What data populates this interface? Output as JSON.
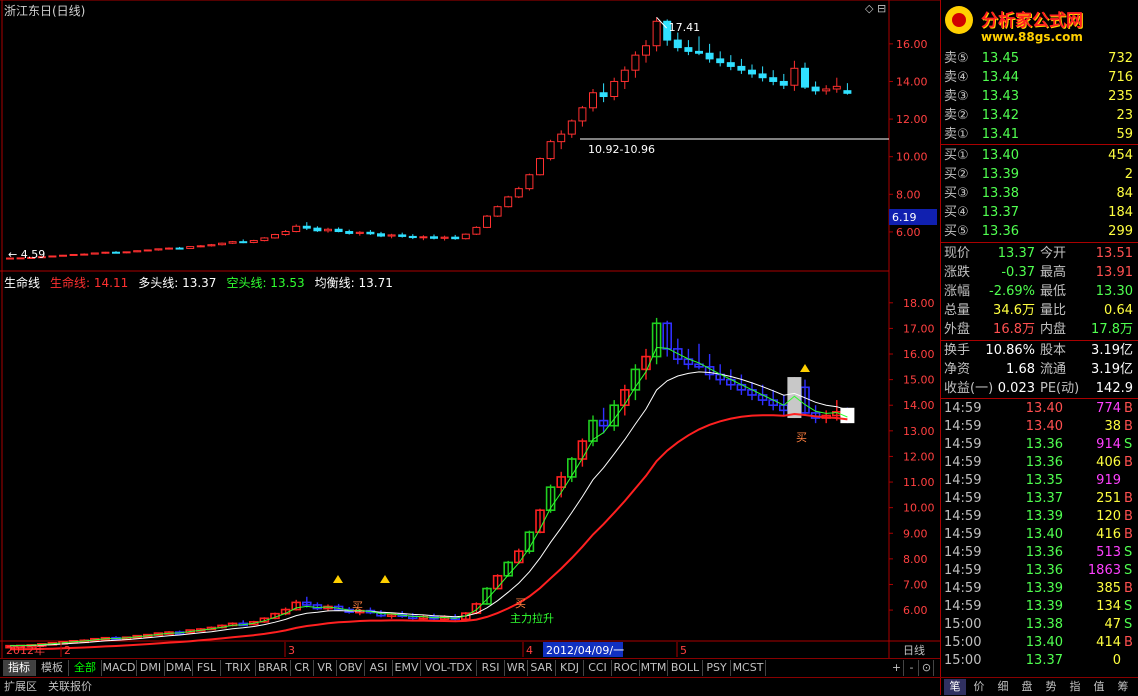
{
  "title": "浙江东日(日线)",
  "logo": {
    "text": "分析家公式网",
    "url": "www.88gs.com"
  },
  "upper": {
    "annotations": {
      "high": "17.41",
      "range": "10.92-10.96",
      "low": "4.59"
    },
    "price_ticks": [
      "16.00",
      "14.00",
      "12.00",
      "10.00",
      "8.00",
      "6.00"
    ],
    "current_price_box": "6.19"
  },
  "lower": {
    "legend": [
      {
        "name": "生命线",
        "value": "",
        "color": "#ffffff"
      },
      {
        "name": "生命线:",
        "value": "14.11",
        "color": "#ff3030"
      },
      {
        "name": "多头线:",
        "value": "13.37",
        "color": "#ffffff"
      },
      {
        "name": "空头线:",
        "value": "13.53",
        "color": "#30ff30"
      },
      {
        "name": "均衡线:",
        "value": "13.71",
        "color": "#ffffff"
      }
    ],
    "price_ticks": [
      "18.00",
      "17.00",
      "16.00",
      "15.00",
      "14.00",
      "13.00",
      "12.00",
      "11.00",
      "10.00",
      "9.00",
      "8.00",
      "7.00",
      "6.00"
    ],
    "labels": {
      "buy1": "买",
      "buy2": "买",
      "buy3": "买",
      "mainforce": "主力拉升"
    }
  },
  "date_axis": {
    "year": "2012年",
    "marks": [
      "2",
      "3",
      "4",
      "5"
    ],
    "cursor_date": "2012/04/09/一",
    "period": "日线"
  },
  "order_book": {
    "asks": [
      {
        "label": "卖⑤",
        "price": "13.45",
        "vol": "732"
      },
      {
        "label": "卖④",
        "price": "13.44",
        "vol": "716"
      },
      {
        "label": "卖③",
        "price": "13.43",
        "vol": "235"
      },
      {
        "label": "卖②",
        "price": "13.42",
        "vol": "23"
      },
      {
        "label": "卖①",
        "price": "13.41",
        "vol": "59"
      }
    ],
    "bids": [
      {
        "label": "买①",
        "price": "13.40",
        "vol": "454"
      },
      {
        "label": "买②",
        "price": "13.39",
        "vol": "2"
      },
      {
        "label": "买③",
        "price": "13.38",
        "vol": "84"
      },
      {
        "label": "买④",
        "price": "13.37",
        "vol": "184"
      },
      {
        "label": "买⑤",
        "price": "13.36",
        "vol": "299"
      }
    ]
  },
  "quote": [
    {
      "l1": "现价",
      "v1": "13.37",
      "c1": "grn",
      "l2": "今开",
      "v2": "13.51",
      "c2": "red"
    },
    {
      "l1": "涨跌",
      "v1": "-0.37",
      "c1": "grn",
      "l2": "最高",
      "v2": "13.91",
      "c2": "red"
    },
    {
      "l1": "涨幅",
      "v1": "-2.69%",
      "c1": "grn",
      "l2": "最低",
      "v2": "13.30",
      "c2": "grn"
    },
    {
      "l1": "总量",
      "v1": "34.6万",
      "c1": "yel",
      "l2": "量比",
      "v2": "0.64",
      "c2": "yel"
    },
    {
      "l1": "外盘",
      "v1": "16.8万",
      "c1": "red",
      "l2": "内盘",
      "v2": "17.8万",
      "c2": "grn"
    },
    {
      "l1": "换手",
      "v1": "10.86%",
      "c1": "wht",
      "l2": "股本",
      "v2": "3.19亿",
      "c2": "wht"
    },
    {
      "l1": "净资",
      "v1": "1.68",
      "c1": "wht",
      "l2": "流通",
      "v2": "3.19亿",
      "c2": "wht"
    },
    {
      "l1": "收益(一)",
      "v1": "0.023",
      "c1": "wht",
      "l2": "PE(动)",
      "v2": "142.9",
      "c2": "wht"
    }
  ],
  "ticks": [
    {
      "t": "14:59",
      "p": "13.40",
      "q": "774",
      "s": "B",
      "pc": "red",
      "qc": "mag",
      "sc": "red"
    },
    {
      "t": "14:59",
      "p": "13.40",
      "q": "38",
      "s": "B",
      "pc": "red",
      "qc": "yel",
      "sc": "red"
    },
    {
      "t": "14:59",
      "p": "13.36",
      "q": "914",
      "s": "S",
      "pc": "grn",
      "qc": "mag",
      "sc": "grn"
    },
    {
      "t": "14:59",
      "p": "13.36",
      "q": "406",
      "s": "B",
      "pc": "grn",
      "qc": "yel",
      "sc": "red"
    },
    {
      "t": "14:59",
      "p": "13.35",
      "q": "919",
      "s": "",
      "pc": "grn",
      "qc": "mag",
      "sc": "wht"
    },
    {
      "t": "14:59",
      "p": "13.37",
      "q": "251",
      "s": "B",
      "pc": "grn",
      "qc": "yel",
      "sc": "red"
    },
    {
      "t": "14:59",
      "p": "13.39",
      "q": "120",
      "s": "B",
      "pc": "grn",
      "qc": "yel",
      "sc": "red"
    },
    {
      "t": "14:59",
      "p": "13.40",
      "q": "416",
      "s": "B",
      "pc": "grn",
      "qc": "yel",
      "sc": "red"
    },
    {
      "t": "14:59",
      "p": "13.36",
      "q": "513",
      "s": "S",
      "pc": "grn",
      "qc": "mag",
      "sc": "grn"
    },
    {
      "t": "14:59",
      "p": "13.36",
      "q": "1863",
      "s": "S",
      "pc": "grn",
      "qc": "mag",
      "sc": "grn"
    },
    {
      "t": "14:59",
      "p": "13.39",
      "q": "385",
      "s": "B",
      "pc": "grn",
      "qc": "yel",
      "sc": "red"
    },
    {
      "t": "14:59",
      "p": "13.39",
      "q": "134",
      "s": "S",
      "pc": "grn",
      "qc": "yel",
      "sc": "grn"
    },
    {
      "t": "15:00",
      "p": "13.38",
      "q": "47",
      "s": "S",
      "pc": "grn",
      "qc": "yel",
      "sc": "grn"
    },
    {
      "t": "15:00",
      "p": "13.40",
      "q": "414",
      "s": "B",
      "pc": "grn",
      "qc": "yel",
      "sc": "red"
    },
    {
      "t": "15:00",
      "p": "13.37",
      "q": "0",
      "s": "",
      "pc": "grn",
      "qc": "yel",
      "sc": "wht"
    }
  ],
  "indicator_tabs": [
    "指标",
    "模板",
    "全部",
    "MACD",
    "DMI",
    "DMA",
    "FSL",
    "TRIX",
    "BRAR",
    "CR",
    "VR",
    "OBV",
    "ASI",
    "EMV",
    "VOL-TDX",
    "RSI",
    "WR",
    "SAR",
    "KDJ",
    "CCI",
    "ROC",
    "MTM",
    "BOLL",
    "PSY",
    "MCST"
  ],
  "bottom_tabs": [
    "扩展区",
    "关联报价"
  ],
  "zoom": {
    "plus": "+",
    "minus": "-",
    "x": "⊙"
  },
  "right_tabs": [
    "笔",
    "价",
    "细",
    "盘",
    "势",
    "指",
    "值",
    "筹"
  ],
  "chart_data": {
    "type": "candlestick",
    "title": "浙江东日(日线)",
    "x_labels": [
      "2012年",
      "2",
      "3",
      "4",
      "5"
    ],
    "ylim_upper": [
      4.4,
      17.8
    ],
    "ylim_lower": [
      5.3,
      18.5
    ],
    "candles": [
      [
        4.6,
        4.62,
        4.58,
        4.61
      ],
      [
        4.61,
        4.63,
        4.59,
        4.62
      ],
      [
        4.62,
        4.66,
        4.6,
        4.64
      ],
      [
        4.64,
        4.7,
        4.62,
        4.68
      ],
      [
        4.68,
        4.74,
        4.66,
        4.72
      ],
      [
        4.72,
        4.78,
        4.7,
        4.76
      ],
      [
        4.76,
        4.82,
        4.74,
        4.8
      ],
      [
        4.8,
        4.86,
        4.76,
        4.82
      ],
      [
        4.82,
        4.9,
        4.8,
        4.88
      ],
      [
        4.88,
        4.94,
        4.84,
        4.92
      ],
      [
        4.92,
        4.98,
        4.88,
        4.9
      ],
      [
        4.9,
        4.96,
        4.86,
        4.94
      ],
      [
        4.94,
        5.02,
        4.92,
        5.0
      ],
      [
        5.0,
        5.06,
        4.96,
        5.04
      ],
      [
        5.04,
        5.12,
        5.0,
        5.1
      ],
      [
        5.1,
        5.18,
        5.06,
        5.14
      ],
      [
        5.14,
        5.2,
        5.08,
        5.12
      ],
      [
        5.12,
        5.24,
        5.1,
        5.22
      ],
      [
        5.22,
        5.3,
        5.18,
        5.26
      ],
      [
        5.26,
        5.36,
        5.22,
        5.32
      ],
      [
        5.32,
        5.44,
        5.28,
        5.4
      ],
      [
        5.4,
        5.52,
        5.36,
        5.48
      ],
      [
        5.48,
        5.6,
        5.4,
        5.44
      ],
      [
        5.44,
        5.58,
        5.4,
        5.54
      ],
      [
        5.54,
        5.72,
        5.5,
        5.68
      ],
      [
        5.68,
        5.9,
        5.64,
        5.86
      ],
      [
        5.86,
        6.1,
        5.8,
        6.02
      ],
      [
        6.02,
        6.4,
        5.98,
        6.3
      ],
      [
        6.3,
        6.52,
        6.1,
        6.2
      ],
      [
        6.2,
        6.3,
        6.0,
        6.06
      ],
      [
        6.06,
        6.22,
        5.96,
        6.14
      ],
      [
        6.14,
        6.24,
        5.98,
        6.02
      ],
      [
        6.02,
        6.12,
        5.86,
        5.92
      ],
      [
        5.92,
        6.04,
        5.8,
        5.98
      ],
      [
        5.98,
        6.1,
        5.84,
        5.9
      ],
      [
        5.9,
        6.0,
        5.72,
        5.78
      ],
      [
        5.78,
        5.9,
        5.66,
        5.84
      ],
      [
        5.84,
        5.96,
        5.7,
        5.76
      ],
      [
        5.76,
        5.88,
        5.62,
        5.7
      ],
      [
        5.7,
        5.82,
        5.56,
        5.74
      ],
      [
        5.74,
        5.86,
        5.6,
        5.66
      ],
      [
        5.66,
        5.8,
        5.54,
        5.72
      ],
      [
        5.72,
        5.84,
        5.58,
        5.64
      ],
      [
        5.64,
        5.92,
        5.6,
        5.88
      ],
      [
        5.88,
        6.3,
        5.84,
        6.24
      ],
      [
        6.24,
        6.9,
        6.2,
        6.84
      ],
      [
        6.84,
        7.4,
        6.8,
        7.34
      ],
      [
        7.34,
        7.92,
        7.3,
        7.86
      ],
      [
        7.86,
        8.4,
        7.8,
        8.3
      ],
      [
        8.3,
        9.1,
        8.2,
        9.04
      ],
      [
        9.04,
        9.96,
        9.0,
        9.9
      ],
      [
        9.9,
        10.9,
        9.8,
        10.8
      ],
      [
        10.8,
        11.4,
        10.4,
        11.2
      ],
      [
        11.2,
        11.98,
        11.0,
        11.9
      ],
      [
        11.9,
        12.7,
        11.6,
        12.6
      ],
      [
        12.6,
        13.6,
        12.4,
        13.4
      ],
      [
        13.4,
        13.9,
        12.9,
        13.2
      ],
      [
        13.2,
        14.2,
        13.0,
        14.0
      ],
      [
        14.0,
        14.8,
        13.6,
        14.6
      ],
      [
        14.6,
        15.6,
        14.2,
        15.4
      ],
      [
        15.4,
        16.2,
        15.0,
        15.9
      ],
      [
        15.9,
        17.41,
        15.6,
        17.2
      ],
      [
        17.2,
        17.3,
        15.9,
        16.2
      ],
      [
        16.2,
        16.6,
        15.6,
        15.8
      ],
      [
        15.8,
        16.2,
        15.4,
        15.6
      ],
      [
        15.6,
        16.4,
        15.4,
        15.5
      ],
      [
        15.5,
        16.0,
        15.0,
        15.2
      ],
      [
        15.2,
        15.6,
        14.8,
        15.0
      ],
      [
        15.0,
        15.4,
        14.6,
        14.8
      ],
      [
        14.8,
        15.2,
        14.4,
        14.6
      ],
      [
        14.6,
        14.9,
        14.2,
        14.4
      ],
      [
        14.4,
        14.8,
        14.0,
        14.2
      ],
      [
        14.2,
        14.6,
        13.8,
        14.0
      ],
      [
        14.0,
        14.4,
        13.6,
        13.8
      ],
      [
        13.8,
        15.1,
        13.5,
        14.7
      ],
      [
        14.7,
        15.0,
        13.6,
        13.7
      ],
      [
        13.7,
        14.0,
        13.3,
        13.5
      ],
      [
        13.5,
        13.8,
        13.3,
        13.6
      ],
      [
        13.6,
        14.2,
        13.4,
        13.74
      ],
      [
        13.51,
        13.91,
        13.3,
        13.37
      ]
    ],
    "series": [
      {
        "name": "生命线",
        "color": "#ff3030"
      },
      {
        "name": "多头线",
        "color": "#ffffff"
      },
      {
        "name": "空头线",
        "color": "#30ff30"
      },
      {
        "name": "均衡线",
        "color": "#ffffff"
      }
    ]
  }
}
